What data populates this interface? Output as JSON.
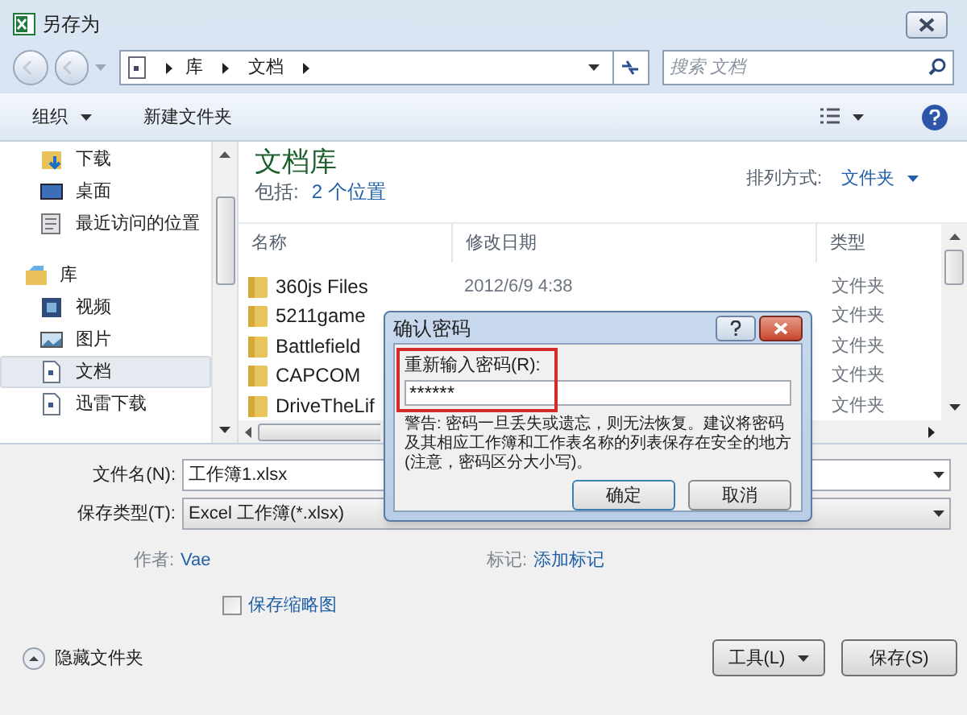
{
  "window": {
    "title": "另存为"
  },
  "address_bar": {
    "path": [
      "库",
      "文档"
    ]
  },
  "search": {
    "placeholder": "搜索 文档"
  },
  "toolbar": {
    "buttons": [
      {
        "label": "组织",
        "dropdown": true
      },
      {
        "label": "新建文件夹",
        "dropdown": false
      }
    ]
  },
  "sidebar": {
    "items": [
      {
        "label": "下载",
        "kind": "download",
        "selected": false
      },
      {
        "label": "桌面",
        "kind": "desktop",
        "selected": false
      },
      {
        "label": "最近访问的位置",
        "kind": "recent",
        "selected": false
      },
      {
        "label": "库",
        "kind": "library",
        "selected": false,
        "children": [
          {
            "label": "视频",
            "kind": "video",
            "selected": false
          },
          {
            "label": "图片",
            "kind": "picture",
            "selected": false
          },
          {
            "label": "文档",
            "kind": "document",
            "selected": true
          },
          {
            "label": "迅雷下载",
            "kind": "document",
            "selected": false
          }
        ]
      }
    ]
  },
  "library": {
    "title": "文档库",
    "includes_label": "包括:",
    "includes_link": "2 个位置",
    "arrange_label": "排列方式:",
    "arrange_value": "文件夹"
  },
  "file_list": {
    "columns": [
      "名称",
      "修改日期",
      "类型"
    ],
    "rows": [
      {
        "name": "360js Files",
        "modified": "2012/6/9 4:38",
        "type": "文件夹"
      },
      {
        "name": "5211game",
        "type": "文件夹"
      },
      {
        "name": "Battlefield",
        "type": "文件夹"
      },
      {
        "name": "CAPCOM",
        "type": "文件夹"
      },
      {
        "name": "DriveTheLif",
        "type": "文件夹"
      }
    ]
  },
  "form": {
    "filename": {
      "label": "文件名(N):",
      "value": "工作簿1.xlsx"
    },
    "filetype": {
      "label": "保存类型(T):",
      "value": "Excel 工作簿(*.xlsx)"
    },
    "author_label": "作者:",
    "author": "Vae",
    "tags_label": "标记:",
    "tags": "添加标记",
    "thumbnail": {
      "label": "保存缩略图",
      "checked": false
    },
    "hide_folders": "隐藏文件夹",
    "tools": "工具(L)",
    "save": "保存(S)"
  },
  "dialog": {
    "title": "确认密码",
    "label": "重新输入密码(R):",
    "value": "******",
    "highlighted": true,
    "warning": "警告: 密码一旦丢失或遗忘，则无法恢复。建议将密码及其相应工作簿和工作表名称的列表保存在安全的地方(注意，密码区分大小写)。",
    "buttons": [
      "确定",
      "取消"
    ]
  }
}
